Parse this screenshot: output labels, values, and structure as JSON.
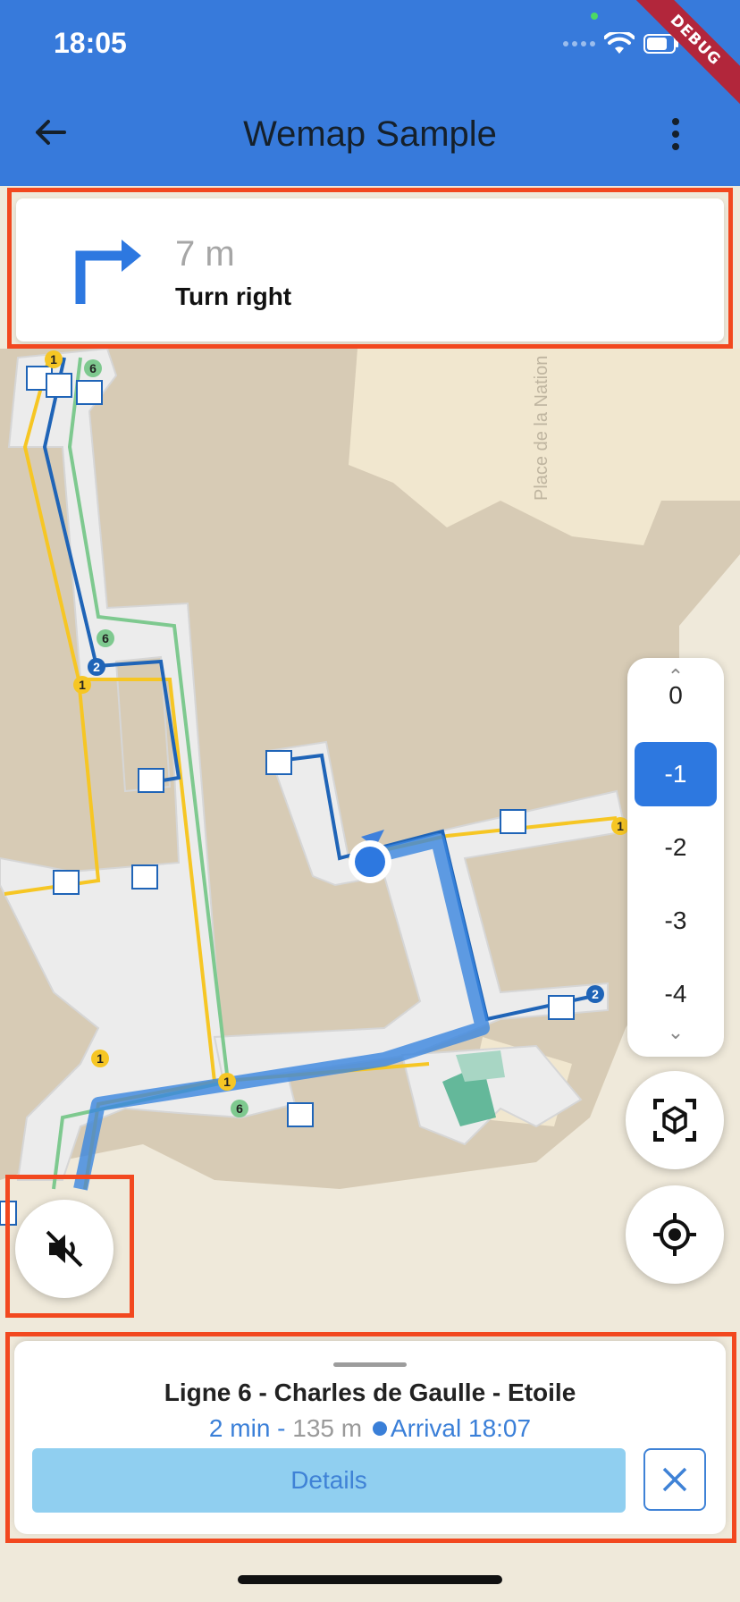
{
  "status_bar": {
    "time": "18:05"
  },
  "debug_banner": "DEBUG",
  "app_bar": {
    "title": "Wemap Sample",
    "back_icon": "arrow-left-icon",
    "menu_icon": "more-vert-icon"
  },
  "instruction": {
    "icon": "turn-right-icon",
    "distance": "7 m",
    "text": "Turn right"
  },
  "map": {
    "street_label": "Place de la Nation",
    "line_badges": [
      "1",
      "6",
      "2"
    ]
  },
  "floor_selector": {
    "partial_above": "0",
    "levels": [
      "-1",
      "-2",
      "-3",
      "-4"
    ],
    "selected": "-1"
  },
  "buttons": {
    "view_3d_icon": "cube-view-icon",
    "locate_icon": "my-location-icon",
    "mute_icon": "volume-off-icon"
  },
  "route": {
    "title": "Ligne 6 - Charles de Gaulle - Etoile",
    "duration": "2 min",
    "separator": "-",
    "distance": "135 m",
    "arrival": "Arrival 18:07",
    "details_label": "Details",
    "close_icon": "close-icon"
  },
  "colors": {
    "app_bar": "#377adb",
    "accent": "#2d78e0",
    "highlight": "#f2481f"
  }
}
